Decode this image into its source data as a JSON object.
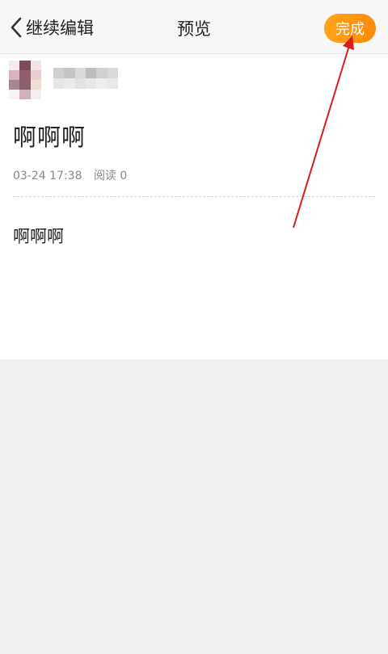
{
  "header": {
    "back_label": "继续编辑",
    "title": "预览",
    "done_label": "完成"
  },
  "post": {
    "title": "啊啊啊",
    "date": "03-24 17:38",
    "reads": "阅读 0",
    "body": "啊啊啊"
  },
  "colors": {
    "accent": "#ff9a14",
    "annotation_arrow": "#d91c1c"
  },
  "icons": {
    "back": "chevron-left-icon"
  }
}
